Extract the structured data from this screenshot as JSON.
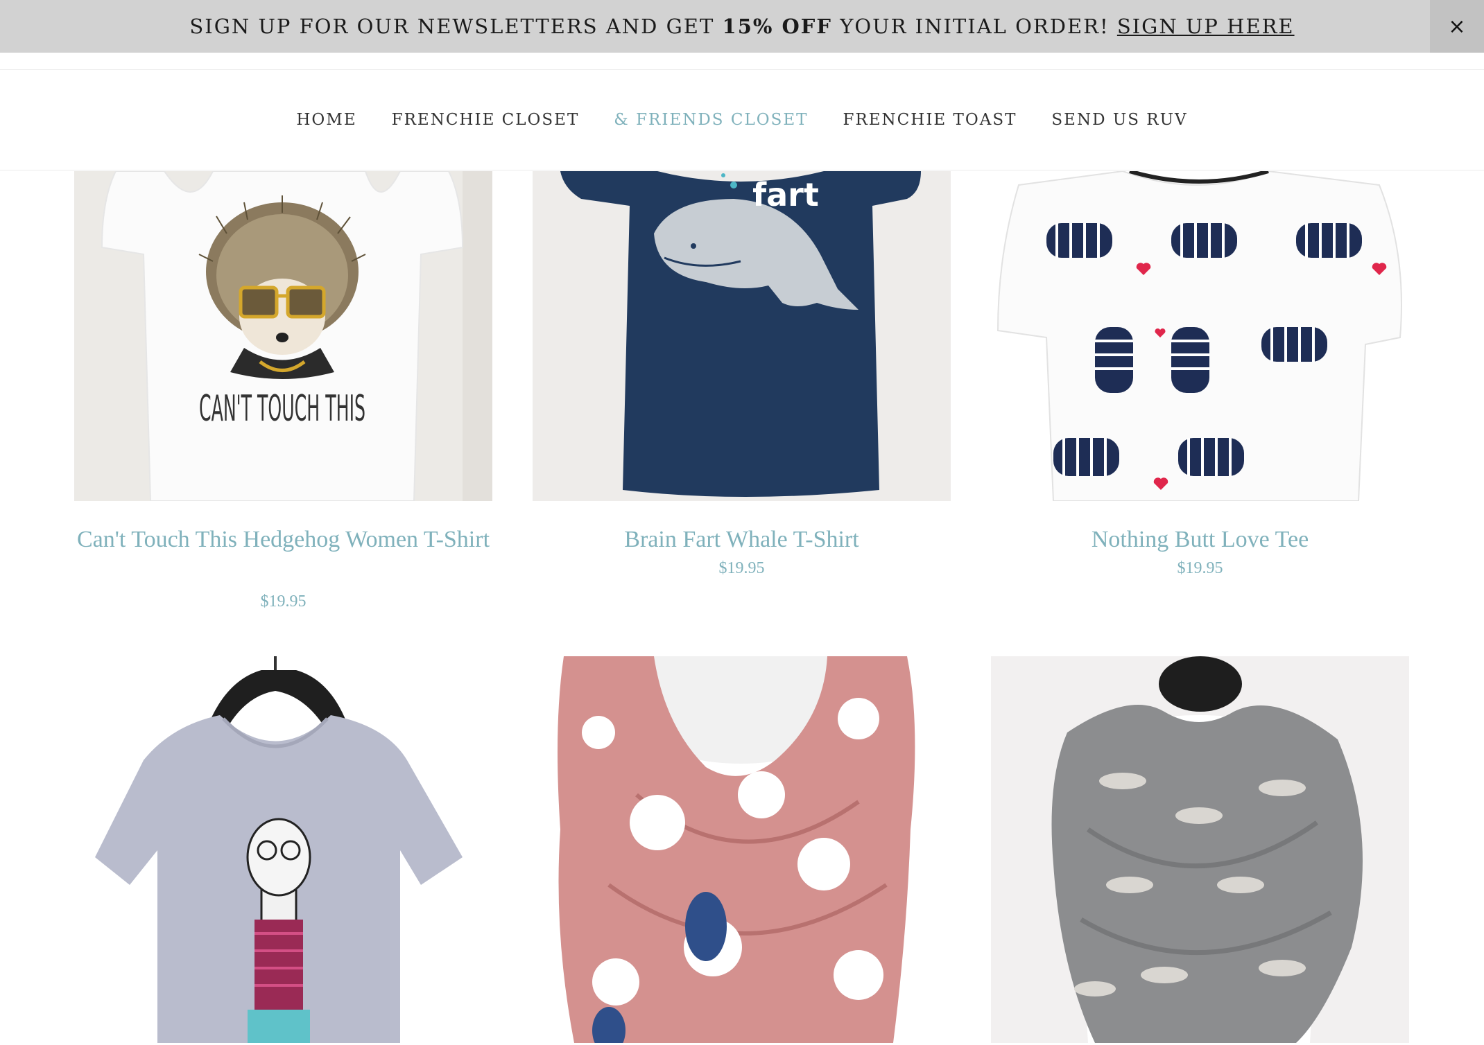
{
  "announcement": {
    "text_before": "SIGN UP FOR OUR NEWSLETTERS AND GET ",
    "bold": "15% OFF",
    "text_after": " YOUR INITIAL ORDER! ",
    "link": "SIGN UP HERE",
    "close": "×"
  },
  "nav": {
    "items": [
      {
        "label": "HOME"
      },
      {
        "label": "FRENCHIE CLOSET"
      },
      {
        "label": "& FRIENDS CLOSET"
      },
      {
        "label": "FRENCHIE TOAST"
      },
      {
        "label": "SEND US RUV"
      }
    ],
    "active_index": 2,
    "accent_color": "#7fb1bb"
  },
  "products": [
    {
      "title": "Can't Touch This Hedgehog Women T-Shirt",
      "price": "$19.95",
      "shirt_text": "CAN'T TOUCH THIS"
    },
    {
      "title": "Brain Fart Whale T-Shirt",
      "price": "$19.95",
      "shirt_text": "fart"
    },
    {
      "title": "Nothing Butt Love Tee",
      "price": "$19.95"
    },
    {},
    {},
    {}
  ]
}
